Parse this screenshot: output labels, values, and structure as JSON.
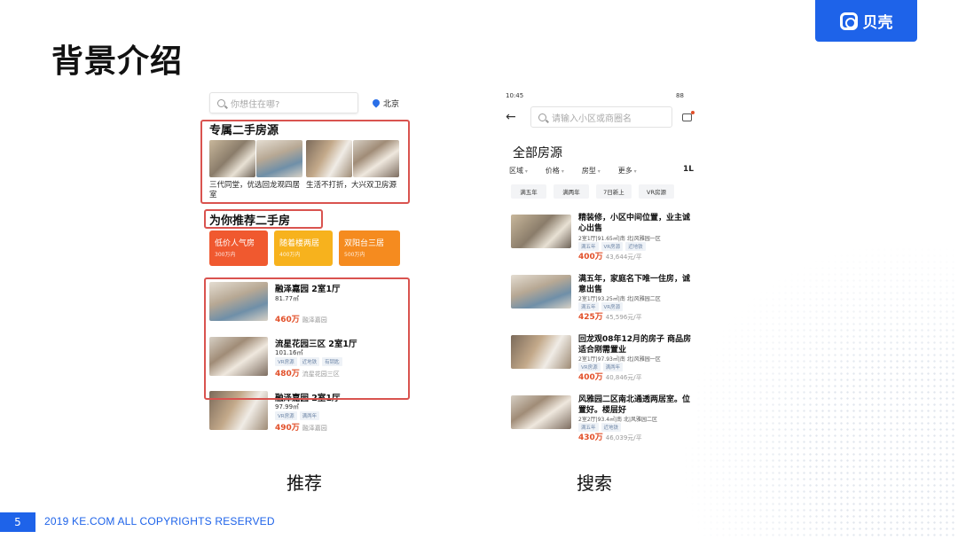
{
  "slide": {
    "title": "背景介绍",
    "brand": "贝壳",
    "page_number": "5",
    "copyright": "2019 KE.COM ALL COPYRIGHTS  RESERVED"
  },
  "captions": {
    "left": "推荐",
    "right": "搜索"
  },
  "left_phone": {
    "search_placeholder": "你想住在哪?",
    "city": "北京",
    "section1_title": "专属二手房源",
    "card1_caption": "三代同堂，优选回龙观四居室",
    "card2_caption": "生活不打折，大兴双卫房源",
    "section2_title": "为你推荐二手房",
    "tiles": [
      {
        "label": "低价人气房",
        "sub": "300万内",
        "color": "#f0592f"
      },
      {
        "label": "随着楼两居",
        "sub": "400万内",
        "color": "#f7b21d"
      },
      {
        "label": "双阳台三居",
        "sub": "500万内",
        "color": "#f58b1f"
      }
    ],
    "listings": [
      {
        "title": "融泽嘉园 2室1厅",
        "area": "81.77㎡",
        "tags": [],
        "price": "460万",
        "community": "融泽嘉园"
      },
      {
        "title": "流星花园三区 2室1厅",
        "area": "101.16㎡",
        "tags": [
          "VR房源",
          "近地铁",
          "有钥匙"
        ],
        "price": "480万",
        "community": "流星花园三区"
      },
      {
        "title": "融泽嘉园 2室1厅",
        "area": "97.99㎡",
        "tags": [
          "VR房源",
          "满两年"
        ],
        "price": "490万",
        "community": "融泽嘉园"
      }
    ]
  },
  "right_phone": {
    "time": "10:45",
    "battery": "88",
    "search_placeholder": "请输入小区或商圈名",
    "heading": "全部房源",
    "filters": [
      "区域",
      "价格",
      "房型",
      "更多"
    ],
    "filters_extra": "1L",
    "chips": [
      "满五年",
      "满两年",
      "7日新上",
      "VR房源"
    ],
    "listings": [
      {
        "title": "精装修，小区中间位置，业主诚心出售",
        "info": "2室1厅|91.65㎡|南 北|风雅园一区",
        "tags": [
          "满五年",
          "VR房源",
          "近地铁"
        ],
        "price": "400万",
        "unit_price": "43,644元/平"
      },
      {
        "title": "满五年，家庭名下唯一住房，诚意出售",
        "info": "2室1厅|93.25㎡|南 北|风雅园二区",
        "tags": [
          "满五年",
          "VR房源"
        ],
        "price": "425万",
        "unit_price": "45,596元/平"
      },
      {
        "title": "回龙观08年12月的房子 商品房 适合刚需置业",
        "info": "2室1厅|97.93㎡|南 北|风雅园一区",
        "tags": [
          "VR房源",
          "满两年"
        ],
        "price": "400万",
        "unit_price": "40,846元/平"
      },
      {
        "title": "风雅园二区南北通透两居室。位置好。楼层好",
        "info": "2室2厅|93.4㎡|南 北|风雅园二区",
        "tags": [
          "满五年",
          "近地铁"
        ],
        "price": "430万",
        "unit_price": "46,039元/平"
      }
    ]
  }
}
